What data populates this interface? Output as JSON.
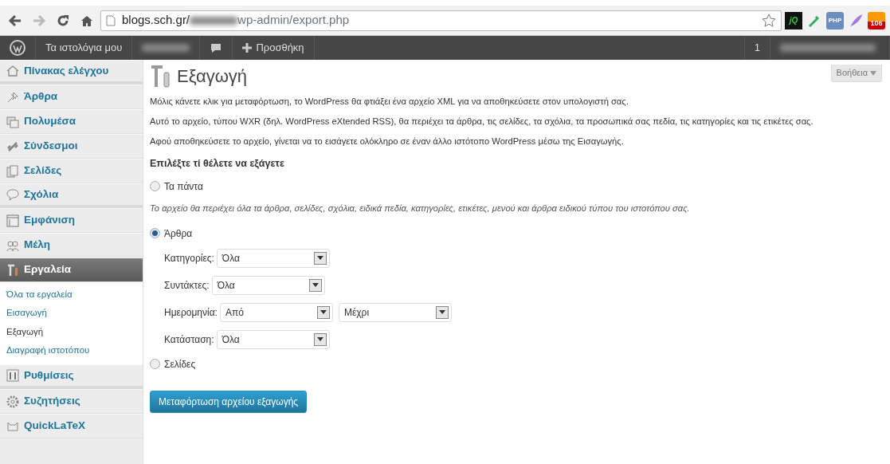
{
  "browser": {
    "url_host": "blogs.sch.gr/",
    "url_path": "wp-admin/export.php",
    "extensions": [
      {
        "kind": "jq",
        "label": "jQ"
      },
      {
        "kind": "dropper"
      },
      {
        "kind": "php",
        "label": "PHP"
      },
      {
        "kind": "feather"
      },
      {
        "kind": "rss",
        "label": "106"
      }
    ]
  },
  "admin_bar": {
    "items": [
      {
        "kind": "logo"
      },
      {
        "kind": "text",
        "label": "Τα ιστολόγια μου"
      },
      {
        "kind": "blurred"
      },
      {
        "kind": "comments"
      },
      {
        "kind": "new",
        "label": "Προσθήκη"
      }
    ],
    "right": [
      {
        "kind": "count",
        "label": "1"
      },
      {
        "kind": "blurred"
      }
    ]
  },
  "sidebar": {
    "items": [
      {
        "label": "Πίνακας ελέγχου",
        "selected": false
      },
      {
        "label": "Άρθρα",
        "selected": false
      },
      {
        "label": "Πολυμέσα",
        "selected": false
      },
      {
        "label": "Σύνδεσμοι",
        "selected": false
      },
      {
        "label": "Σελίδες",
        "selected": false
      },
      {
        "label": "Σχόλια",
        "selected": false
      },
      {
        "label": "Εμφάνιση",
        "selected": false
      },
      {
        "label": "Μέλη",
        "selected": false
      },
      {
        "label": "Εργαλεία",
        "selected": true,
        "children": [
          {
            "label": "Όλα τα εργαλεία",
            "selected": false
          },
          {
            "label": "Εισαγωγή",
            "selected": false
          },
          {
            "label": "Εξαγωγή",
            "selected": true
          },
          {
            "label": "Διαγραφή ιστοτόπου",
            "selected": false
          }
        ]
      },
      {
        "label": "Ρυθμίσεις",
        "selected": false
      },
      {
        "label": "Συζητήσεις",
        "selected": false
      },
      {
        "label": "QuickLaTeX",
        "selected": false
      }
    ]
  },
  "page": {
    "title": "Εξαγωγή",
    "help_button": "Βοήθεια",
    "paragraphs": [
      "Μόλις κάνετε κλικ για μεταφόρτωση, το WordPress θα φτιάξει ένα αρχείο XML για να αποθηκεύσετε στον υπολογιστή σας.",
      "Αυτό το αρχείο, τύπου WXR (δηλ. WordPress eXtended RSS), θα περιέχει τα άρθρα, τις σελίδες, τα σχόλια, τα προσωπικά σας πεδία, τις κατηγορίες και τις ετικέτες σας.",
      "Αφού αποθηκεύσετε το αρχείο, γίνεται να το εισάγετε ολόκληρο σε έναν άλλο ιστότοπο WordPress μέσω της Εισαγωγής."
    ],
    "section_title": "Επιλέξτε τί θέλετε να εξάγετε",
    "options": [
      {
        "label": "Τα πάντα",
        "selected": false,
        "description": "Το αρχείο θα περιέχει όλα τα άρθρα, σελίδες, σχόλια, ειδικά πεδία, κατηγορίες, ετικέτες, μενού και άρθρα ειδικού τύπου του ιστοτόπου σας."
      },
      {
        "label": "Άρθρα",
        "selected": true,
        "filters": [
          {
            "label": "Κατηγορίες:",
            "selects": [
              "Όλα"
            ]
          },
          {
            "label": "Συντάκτες:",
            "selects": [
              "Όλα"
            ]
          },
          {
            "label": "Ημερομηνία:",
            "selects": [
              "Από",
              "Μέχρι"
            ]
          },
          {
            "label": "Κατάσταση:",
            "selects": [
              "Όλα"
            ]
          }
        ]
      },
      {
        "label": "Σελίδες",
        "selected": false
      }
    ],
    "submit_button": "Μεταφόρτωση αρχείου εξαγωγής"
  }
}
